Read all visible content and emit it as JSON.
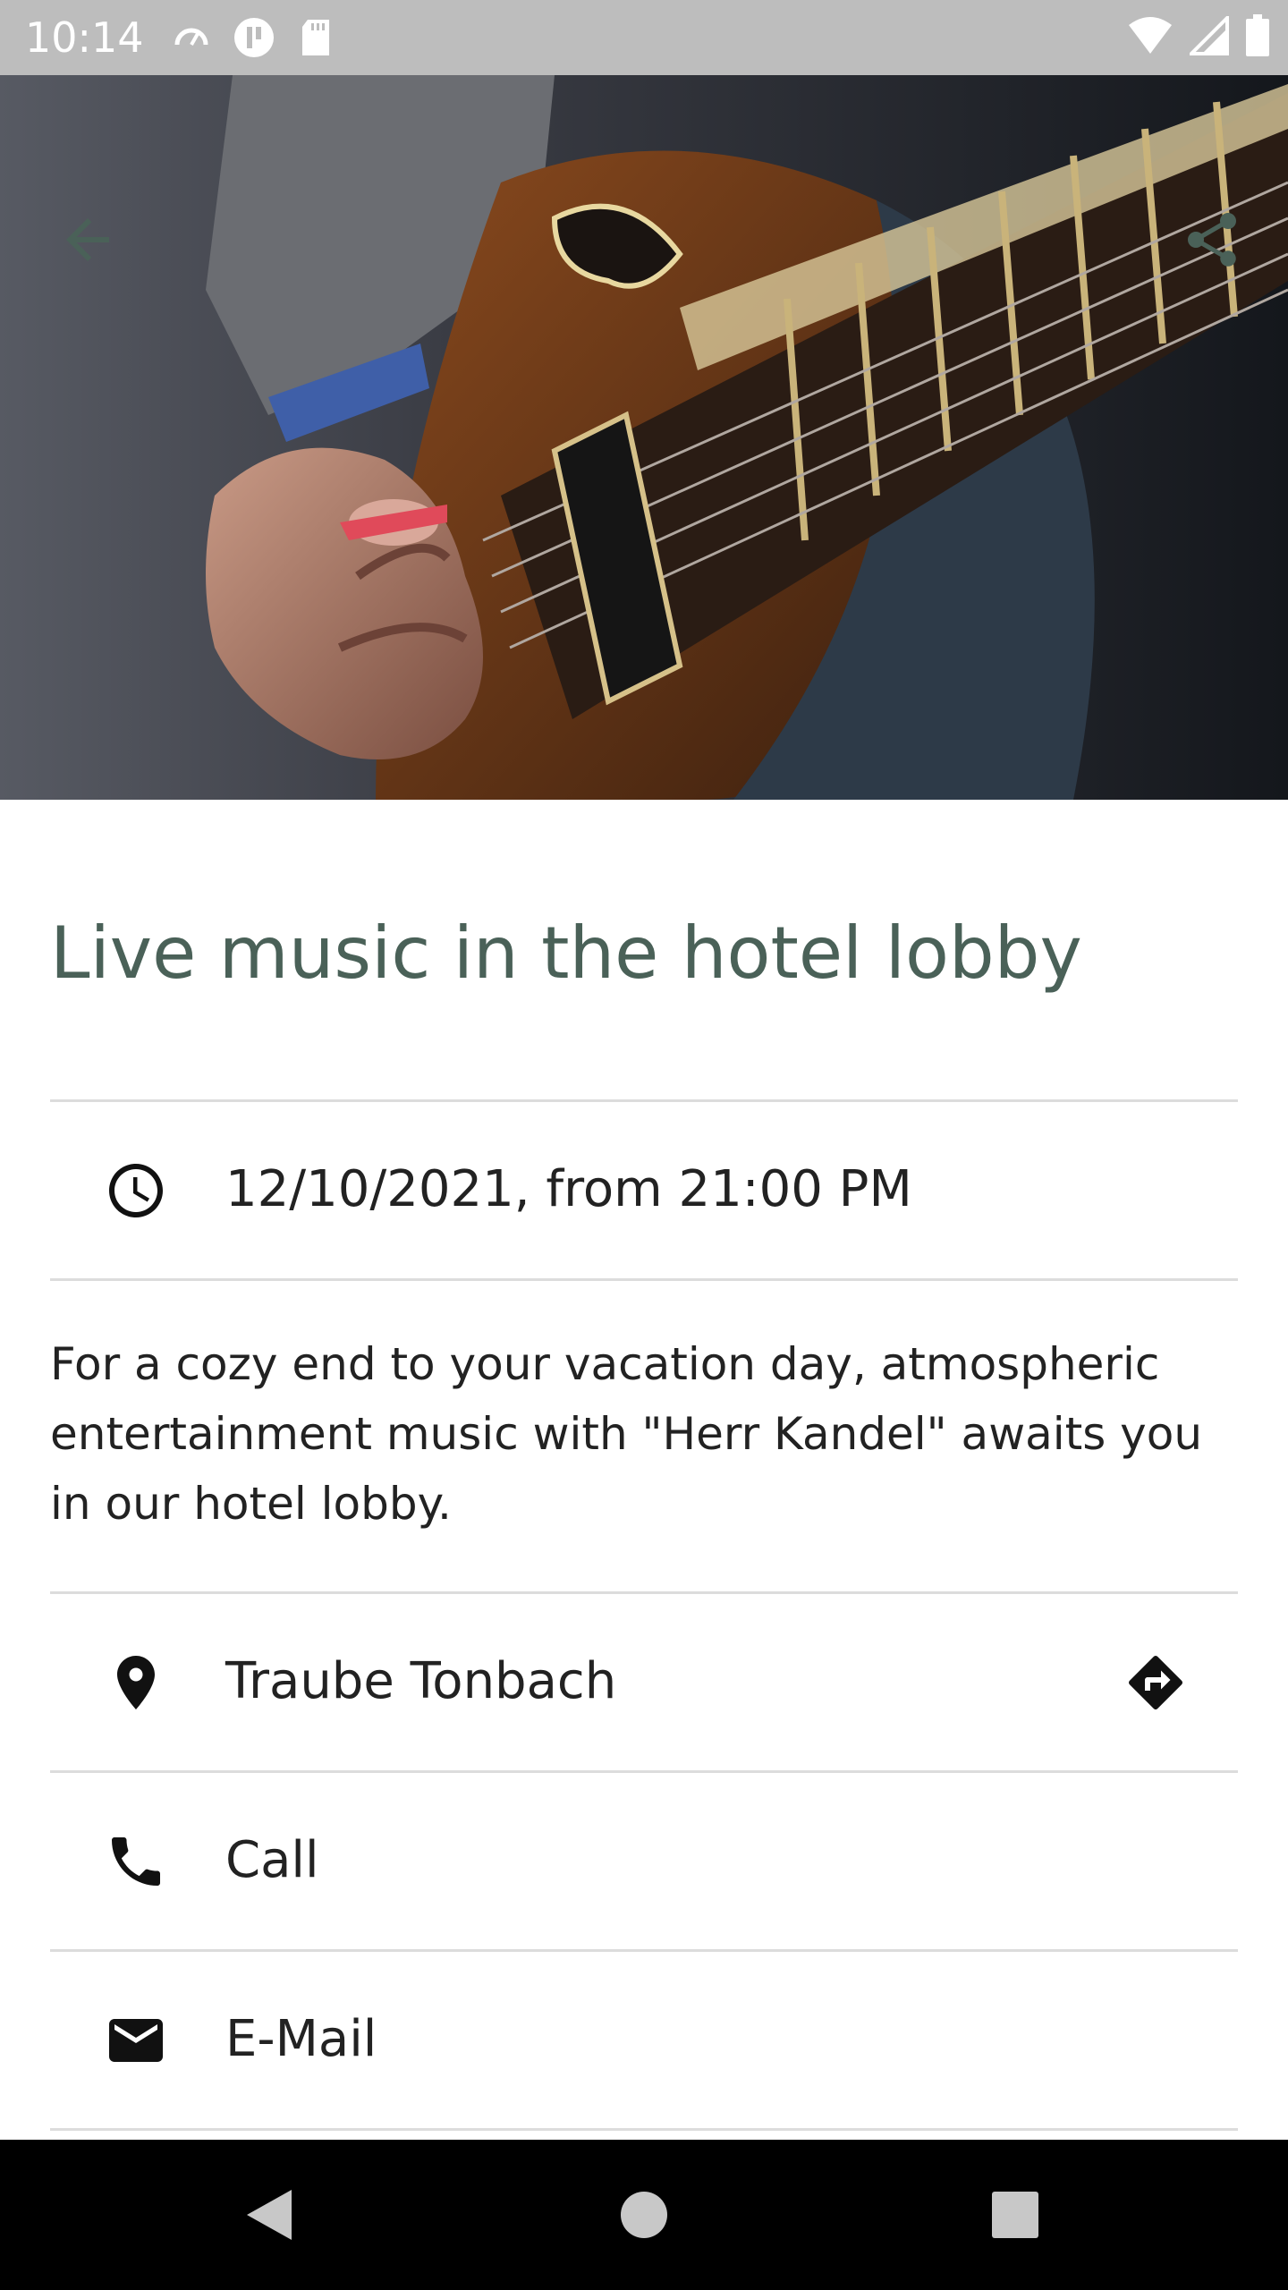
{
  "status_bar": {
    "time": "10:14",
    "left_icons": [
      "speed-icon",
      "app-badge-icon",
      "sd-card-icon"
    ],
    "right_icons": [
      "wifi-icon",
      "cellular-signal-icon",
      "battery-icon"
    ]
  },
  "app_bar": {
    "back_icon": "arrow-back-icon",
    "share_icon": "share-icon",
    "icon_color": "#4a6158"
  },
  "event": {
    "title": "Live music in the hotel lobby",
    "datetime": "12/10/2021, from 21:00 PM",
    "description": "For a cozy end to your vacation day, atmospheric entertainment music with \"Herr Kandel\" awaits you in our hotel lobby.",
    "location": "Traube Tonbach",
    "call_label": "Call",
    "email_label": "E-Mail"
  },
  "colors": {
    "title": "#4a6158",
    "status_bar": "#bdbdbd",
    "text": "#222222",
    "divider": "#dcdcdc"
  },
  "nav_bar": {
    "buttons": [
      "back-triangle-icon",
      "home-circle-icon",
      "recents-square-icon"
    ]
  }
}
